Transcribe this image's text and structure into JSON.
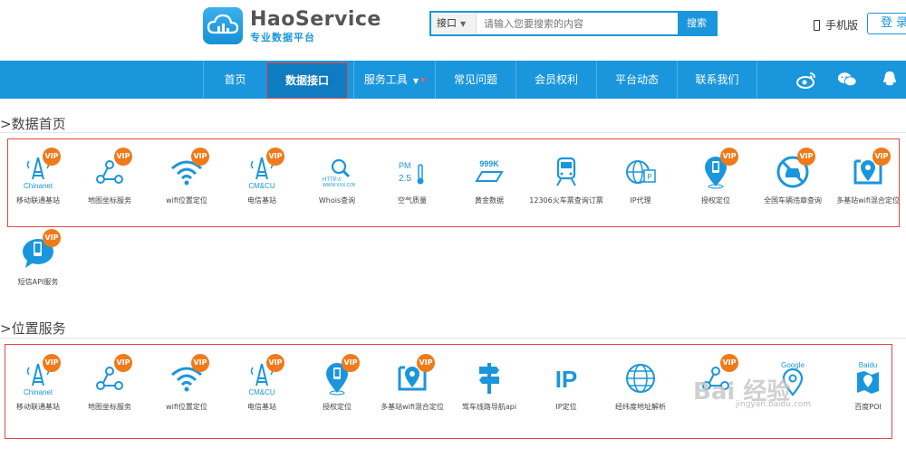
{
  "header": {
    "brand": "HaoService",
    "subtitle": "专业数据平台",
    "search": {
      "select_label": "接口",
      "placeholder": "请输入您要搜索的内容",
      "button_label": "搜索"
    },
    "mobile_label": "手机版",
    "login_label": "登 录"
  },
  "nav": {
    "items": [
      {
        "label": "首页"
      },
      {
        "label": "数据接口",
        "active": true
      },
      {
        "label": "服务工具"
      },
      {
        "label": "常见问题"
      },
      {
        "label": "会员权利"
      },
      {
        "label": "平台动态"
      },
      {
        "label": "联系我们"
      }
    ],
    "social": [
      "weibo-icon",
      "wechat-icon",
      "qq-icon"
    ]
  },
  "sections": [
    {
      "title": ">数据首页",
      "items": [
        {
          "label": "移动联通基站",
          "icon": "chinanet-tower-icon",
          "vip": true
        },
        {
          "label": "地图坐标服务",
          "icon": "map-coordinate-icon",
          "vip": true
        },
        {
          "label": "wifi位置定位",
          "icon": "wifi-icon",
          "vip": true
        },
        {
          "label": "电信基站",
          "icon": "cmcu-tower-icon",
          "vip": true
        },
        {
          "label": "Whois查询",
          "icon": "whois-search-icon",
          "vip": false
        },
        {
          "label": "空气质量",
          "icon": "air-quality-icon",
          "vip": false
        },
        {
          "label": "黄金数据",
          "icon": "gold-icon",
          "vip": false
        },
        {
          "label": "12306火车票查询订票",
          "icon": "train-icon",
          "vip": false
        },
        {
          "label": "IP代理",
          "icon": "ip-proxy-icon",
          "vip": false
        },
        {
          "label": "授权定位",
          "icon": "location-pin-icon",
          "vip": true
        },
        {
          "label": "全国车辆违章查询",
          "icon": "no-car-icon",
          "vip": true
        },
        {
          "label": "多基站wifi混合定位",
          "icon": "hybrid-location-icon",
          "vip": true
        },
        {
          "label": "短信API服务",
          "icon": "sms-icon",
          "vip": true
        }
      ]
    },
    {
      "title": ">位置服务",
      "items": [
        {
          "label": "移动联通基站",
          "icon": "chinanet-tower-icon",
          "vip": true
        },
        {
          "label": "地图坐标服务",
          "icon": "map-coordinate-icon",
          "vip": true
        },
        {
          "label": "wifi位置定位",
          "icon": "wifi-icon",
          "vip": true
        },
        {
          "label": "电信基站",
          "icon": "cmcu-tower-icon",
          "vip": true
        },
        {
          "label": "授权定位",
          "icon": "location-pin-icon",
          "vip": true
        },
        {
          "label": "多基站wifi混合定位",
          "icon": "hybrid-location-icon",
          "vip": true
        },
        {
          "label": "驾车线路导航api",
          "icon": "signpost-icon",
          "vip": false
        },
        {
          "label": "IP定位",
          "icon": "ip-icon",
          "vip": false
        },
        {
          "label": "经纬度地址解析",
          "icon": "globe-icon",
          "vip": false
        },
        {
          "label": "",
          "icon": "map-coordinate-icon",
          "vip": true
        },
        {
          "label": "",
          "icon": "google-poi-icon",
          "vip": false,
          "brand": "Google"
        },
        {
          "label": "百度POI",
          "icon": "baidu-poi-icon",
          "vip": false,
          "brand": "Baidu"
        }
      ]
    }
  ],
  "vip_label": "VIP",
  "watermark": {
    "text": "Bai 经验",
    "url": "jingyan.baidu.com"
  },
  "colors": {
    "primary": "#1a96dd",
    "vip": "#f07a1a",
    "frame": "#e34848"
  }
}
